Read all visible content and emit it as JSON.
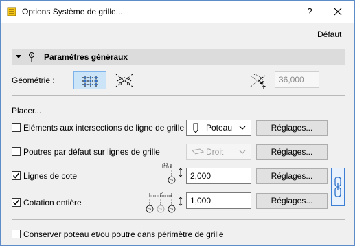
{
  "window": {
    "title": "Options Système de grille...",
    "help_label": "?",
    "default_label": "Défaut"
  },
  "section": {
    "title": "Paramètres généraux"
  },
  "geometry": {
    "label": "Géométrie :",
    "angle_value": "36,000",
    "modes": [
      "orthogonal-grid-icon",
      "polar-grid-icon"
    ],
    "selected_mode": "orthogonal-grid-icon"
  },
  "placer": {
    "heading": "Placer...",
    "rows": [
      {
        "label": "Eléments aux intersections de ligne de grille",
        "checked": false,
        "combo": "Poteau",
        "combo_enabled": true,
        "button": "Réglages..."
      },
      {
        "label": "Poutres par défaut sur lignes de grille",
        "checked": false,
        "combo": "Droit",
        "combo_enabled": false,
        "button": "Réglages..."
      },
      {
        "label": "Lignes de cote",
        "checked": true,
        "value": "2,000",
        "button": "Réglages..."
      },
      {
        "label": "Cotation entière",
        "checked": true,
        "value": "1,000",
        "button": "Réglages..."
      }
    ],
    "dim_text": "1.2",
    "marker_text": "Y5"
  },
  "footer": {
    "label": "Conserver poteau et/ou poutre dans périmètre de grille",
    "checked": false
  },
  "colors": {
    "accent": "#3c7fd4",
    "selected_bg": "#cce4f7",
    "section_bg": "#dcdcdc"
  }
}
